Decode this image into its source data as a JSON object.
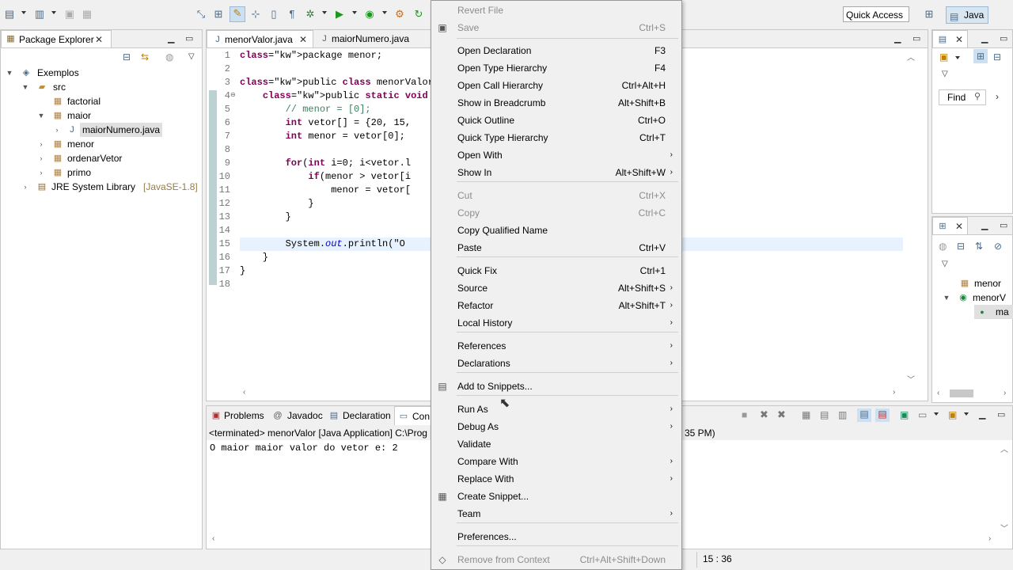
{
  "toolbar": {
    "quick_access": "Quick Access",
    "perspective": "Java"
  },
  "package_explorer": {
    "tab_label": "Package Explorer",
    "tree": [
      {
        "label": "Exemplos",
        "icon": "project-icon"
      },
      {
        "label": "src",
        "icon": "source-folder-icon"
      },
      {
        "label": "factorial",
        "icon": "package-icon"
      },
      {
        "label": "maior",
        "icon": "package-icon"
      },
      {
        "label": "maiorNumero.java",
        "icon": "java-file-icon"
      },
      {
        "label": "menor",
        "icon": "package-icon"
      },
      {
        "label": "ordenarVetor",
        "icon": "package-icon"
      },
      {
        "label": "primo",
        "icon": "package-icon"
      },
      {
        "label": "JRE System Library",
        "icon": "library-icon",
        "suffix": "[JavaSE-1.8]"
      }
    ]
  },
  "editor": {
    "tabs": [
      {
        "label": "menorValor.java"
      },
      {
        "label": "maiorNumero.java"
      }
    ],
    "line_numbers": [
      "1",
      "2",
      "3",
      "4",
      "5",
      "6",
      "7",
      "8",
      "9",
      "10",
      "11",
      "12",
      "13",
      "14",
      "15",
      "16",
      "17",
      "18"
    ],
    "lines": [
      "package menor;",
      "",
      "public class menorValor {",
      "    public static void main(St",
      "        // menor = [0];",
      "        int vetor[] = {20, 15,",
      "        int menor = vetor[0];",
      "",
      "        for(int i=0; i<vetor.l",
      "            if(menor > vetor[i",
      "                menor = vetor[",
      "            }",
      "        }",
      "",
      "        System.out.println(\"O",
      "    }",
      "}",
      ""
    ]
  },
  "console": {
    "tabs": [
      {
        "label": "Problems"
      },
      {
        "label": "Javadoc"
      },
      {
        "label": "Declaration"
      },
      {
        "label": "Con"
      }
    ],
    "header": "<terminated> menorValor [Java Application] C:\\Prog",
    "header_tail": "35 PM)",
    "output": "O maior maior valor do vetor e: 2"
  },
  "right_panel": {
    "find_label": "Find",
    "outline_items": [
      {
        "label": "menor"
      },
      {
        "label": "menorV"
      },
      {
        "label": "ma"
      }
    ]
  },
  "status": {
    "position": "15 : 36"
  },
  "context_menu": {
    "items": [
      {
        "label": "Revert File",
        "shortcut": "",
        "disabled": true
      },
      {
        "label": "Save",
        "shortcut": "Ctrl+S",
        "disabled": true
      },
      {
        "label": "Open Declaration",
        "shortcut": "F3"
      },
      {
        "label": "Open Type Hierarchy",
        "shortcut": "F4"
      },
      {
        "label": "Open Call Hierarchy",
        "shortcut": "Ctrl+Alt+H"
      },
      {
        "label": "Show in Breadcrumb",
        "shortcut": "Alt+Shift+B"
      },
      {
        "label": "Quick Outline",
        "shortcut": "Ctrl+O"
      },
      {
        "label": "Quick Type Hierarchy",
        "shortcut": "Ctrl+T"
      },
      {
        "label": "Open With",
        "shortcut": ""
      },
      {
        "label": "Show In",
        "shortcut": "Alt+Shift+W"
      },
      {
        "label": "Cut",
        "shortcut": "Ctrl+X",
        "disabled": true
      },
      {
        "label": "Copy",
        "shortcut": "Ctrl+C",
        "disabled": true
      },
      {
        "label": "Copy Qualified Name",
        "shortcut": ""
      },
      {
        "label": "Paste",
        "shortcut": "Ctrl+V"
      },
      {
        "label": "Quick Fix",
        "shortcut": "Ctrl+1"
      },
      {
        "label": "Source",
        "shortcut": "Alt+Shift+S"
      },
      {
        "label": "Refactor",
        "shortcut": "Alt+Shift+T"
      },
      {
        "label": "Local History",
        "shortcut": ""
      },
      {
        "label": "References",
        "shortcut": ""
      },
      {
        "label": "Declarations",
        "shortcut": ""
      },
      {
        "label": "Add to Snippets...",
        "shortcut": ""
      },
      {
        "label": "Run As",
        "shortcut": ""
      },
      {
        "label": "Debug As",
        "shortcut": ""
      },
      {
        "label": "Validate",
        "shortcut": ""
      },
      {
        "label": "Compare With",
        "shortcut": ""
      },
      {
        "label": "Replace With",
        "shortcut": ""
      },
      {
        "label": "Create Snippet...",
        "shortcut": ""
      },
      {
        "label": "Team",
        "shortcut": ""
      },
      {
        "label": "Preferences...",
        "shortcut": ""
      },
      {
        "label": "Remove from Context",
        "shortcut": "Ctrl+Alt+Shift+Down",
        "disabled": true
      }
    ]
  },
  "colors": {
    "accent": "#d8e6f2",
    "keyword": "#7f0055",
    "comment": "#3f7f5f",
    "field": "#0000c0",
    "selection": "#e8f2fe"
  }
}
